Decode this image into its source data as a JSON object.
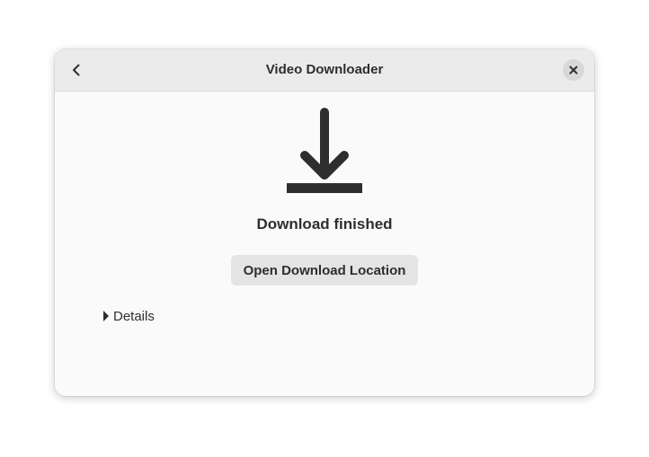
{
  "window": {
    "title": "Video Downloader"
  },
  "headerbar": {
    "back_icon": "chevron-left-icon",
    "close_icon": "close-icon"
  },
  "main": {
    "icon": "download-icon",
    "status": "Download finished",
    "open_location_label": "Open Download Location",
    "details_label": "Details",
    "details_expanded": false
  },
  "colors": {
    "headerbar_bg": "#ebebeb",
    "window_bg": "#fafafa",
    "button_bg": "#e4e4e4",
    "text": "#2e2e2e"
  }
}
